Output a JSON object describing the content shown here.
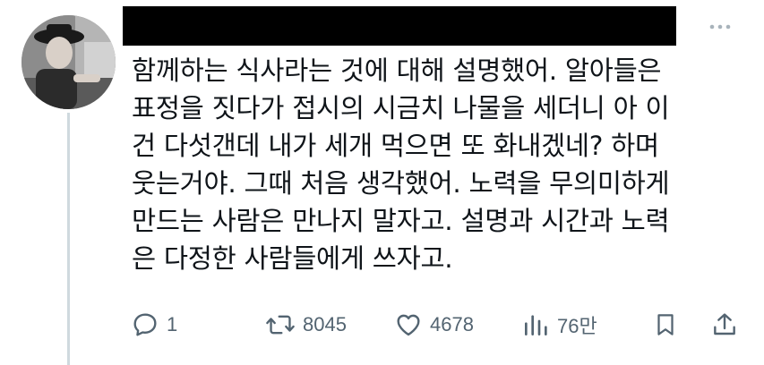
{
  "tweet": {
    "text_lines": [
      "함께하는 식사라는 것에 대해 설명했어. 알아들은",
      "표정을 짓다가 접시의 시금치 나물을 세더니 아 이",
      "건 다섯갠데 내가 세개 먹으면 또 화내겠네? 하며",
      "웃는거야. 그때 처음 생각했어. 노력을 무의미하게",
      "만드는 사람은 만나지 말자고. 설명과 시간과 노력",
      "은 다정한 사람들에게 쓰자고."
    ]
  },
  "actions": {
    "reply_count": "1",
    "retweet_count": "8045",
    "like_count": "4678",
    "views_count": "76만"
  },
  "icons": {
    "more": "more-dots-icon",
    "reply": "reply-icon",
    "retweet": "retweet-icon",
    "like": "heart-icon",
    "views": "views-icon",
    "bookmark": "bookmark-icon",
    "share": "share-icon"
  },
  "colors": {
    "text": "#0f1419",
    "secondary": "#536471",
    "thread_line": "#cfd9de",
    "redaction": "#000000"
  }
}
